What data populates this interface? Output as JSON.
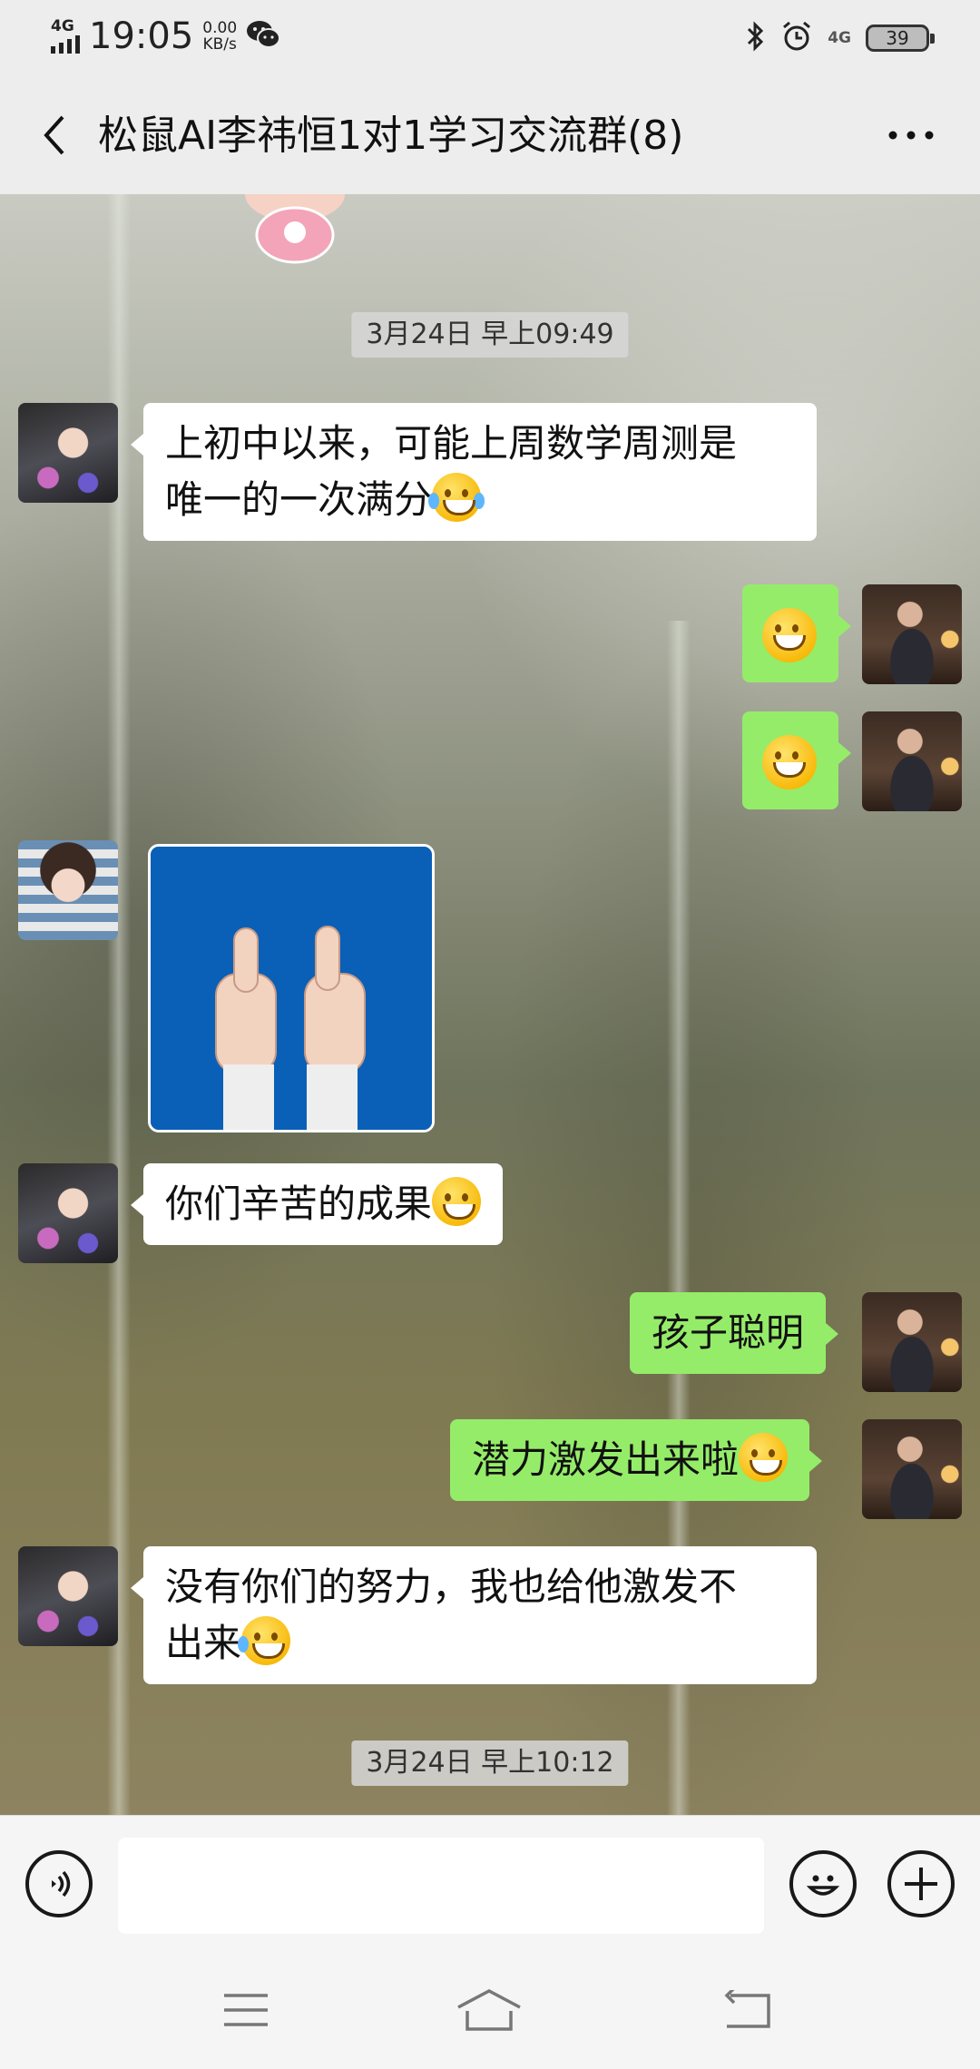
{
  "status_bar": {
    "network": "4G",
    "time": "19:05",
    "speed_value": "0.00",
    "speed_unit": "KB/s",
    "network_right": "4G",
    "battery": "39",
    "icons": [
      "signal-icon",
      "wechat-icon",
      "bluetooth-icon",
      "alarm-icon",
      "mobile-data-icon",
      "battery-icon"
    ]
  },
  "header": {
    "title": "松鼠AI李祎恒1对1学习交流群(8)",
    "back_icon": "chevron-left-icon",
    "more_icon": "more-dots-icon"
  },
  "chat": {
    "timestamps": [
      "3月24日 早上09:49",
      "3月24日 早上10:12"
    ],
    "messages": [
      {
        "side": "left",
        "avatar": "avatar-mother",
        "text": "上初中以来，可能上周数学周测是",
        "text2": "唯一的一次满分",
        "emoji": "laughing-tears-emoji"
      },
      {
        "side": "right",
        "avatar": "avatar-teacher",
        "emoji": "shy-face-emoji"
      },
      {
        "side": "right",
        "avatar": "avatar-teacher",
        "emoji": "grinning-face-emoji"
      },
      {
        "side": "left",
        "avatar": "avatar-child",
        "sticker": "thumbs-up-sticker"
      },
      {
        "side": "left",
        "avatar": "avatar-mother",
        "text": "你们辛苦的成果",
        "emoji": "grin-emoji"
      },
      {
        "side": "right",
        "avatar": "avatar-teacher",
        "text": "孩子聪明"
      },
      {
        "side": "right",
        "avatar": "avatar-teacher",
        "text": "潜力激发出来啦",
        "emoji": "grinning-face-emoji"
      },
      {
        "side": "left",
        "avatar": "avatar-mother",
        "text": "没有你们的努力，我也给他激发不",
        "text2": "出来",
        "emoji": "crying-laughing-emoji"
      }
    ]
  },
  "input_bar": {
    "voice_icon": "voice-icon",
    "emoji_icon": "emoji-icon",
    "add_icon": "plus-icon",
    "input_value": ""
  },
  "nav_bar": {
    "icons": [
      "menu-icon",
      "home-icon",
      "back-icon"
    ]
  },
  "colors": {
    "bubble_out": "#95ec69",
    "bubble_in": "#ffffff",
    "bar_bg": "#ededed",
    "sticker_blue": "#0a60b7"
  }
}
